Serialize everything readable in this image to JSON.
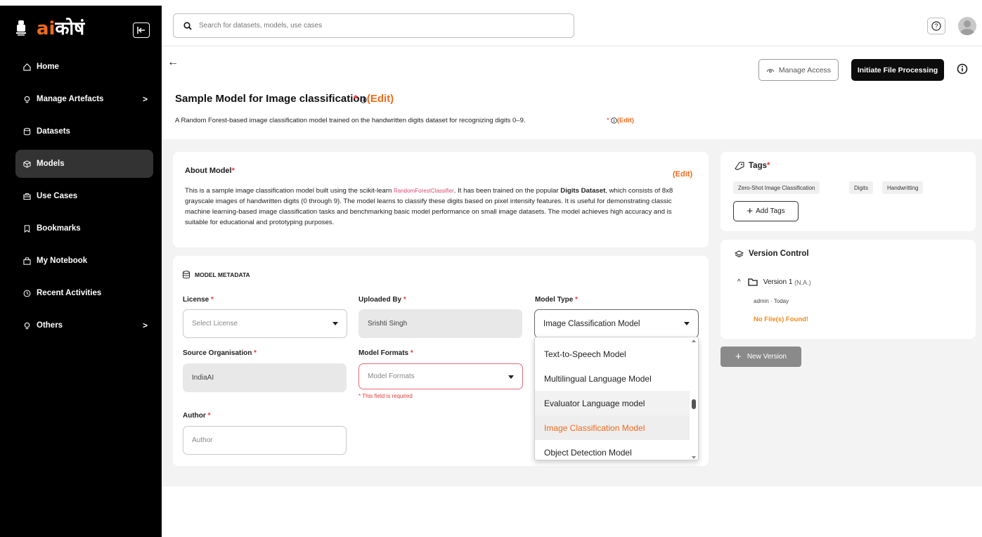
{
  "brand": {
    "prefix": "ai",
    "suffix": "कोषं"
  },
  "sidebar": {
    "items": [
      {
        "label": "Home",
        "icon": "home-icon"
      },
      {
        "label": "Manage Artefacts",
        "icon": "bulb-icon",
        "chevron": ">"
      },
      {
        "label": "Datasets",
        "icon": "database-icon"
      },
      {
        "label": "Models",
        "icon": "cube-icon",
        "active": true
      },
      {
        "label": "Use Cases",
        "icon": "briefcase-icon"
      },
      {
        "label": "Bookmarks",
        "icon": "bookmark-icon"
      },
      {
        "label": "My Notebook",
        "icon": "notebook-icon"
      },
      {
        "label": "Recent Activities",
        "icon": "clock-icon"
      },
      {
        "label": "Others",
        "icon": "bulb-icon",
        "chevron": ">"
      }
    ]
  },
  "search": {
    "placeholder": "Search for datasets, models, use cases"
  },
  "header": {
    "back": "←",
    "manage_access": "Manage Access",
    "initiate": "Initiate File Processing"
  },
  "page": {
    "title": "Sample Model for Image classification",
    "required_mark": "*",
    "edit": "(Edit)",
    "subtitle": "A Random Forest-based image classification model trained on the handwritten digits dataset for recognizing digits 0–9."
  },
  "about": {
    "title": "About Model",
    "required_mark": "*",
    "edit": "(Edit)",
    "text_1": "This is a sample image classification model built using the scikit-learn ",
    "code": "RandomForestClassifier",
    "text_2": ". It has been trained on the popular ",
    "bold_1": "Digits Dataset",
    "text_3": ", which consists of 8x8 grayscale images of handwritten digits (0 through 9). The model learns to classify these digits based on pixel intensity features. It is useful for demonstrating classic machine learning-based image classification tasks and benchmarking basic model performance on small image datasets. The model achieves high accuracy and is suitable for educational and prototyping purposes."
  },
  "metadata": {
    "heading": "MODEL METADATA",
    "license": {
      "label": "License",
      "required": "*",
      "placeholder": "Select License"
    },
    "uploaded_by": {
      "label": "Uploaded By",
      "required": "*",
      "value": "Srishti Singh"
    },
    "model_type": {
      "label": "Model Type",
      "required": "*",
      "value": "Image Classification Model"
    },
    "source_org": {
      "label": "Source Organisation",
      "required": "*",
      "value": "IndiaAI"
    },
    "model_formats": {
      "label": "Model Formats",
      "required": "*",
      "placeholder": "Model Formats",
      "error": "* This field is required"
    },
    "author": {
      "label": "Author",
      "required": "*",
      "placeholder": "Author"
    }
  },
  "model_type_options": [
    "Text-to-Speech Model",
    "Multilingual Language Model",
    "Evaluator Language model",
    "Image Classification Model",
    "Object Detection Model"
  ],
  "tags": {
    "title": "Tags",
    "required_mark": "*",
    "items": [
      "Zero-Shot Image Classification",
      "Digits",
      "Handwritting"
    ],
    "add": "Add Tags"
  },
  "version_control": {
    "title": "Version Control",
    "version": "Version 1",
    "version_note": "(N.A.)",
    "meta": "admin · Today",
    "empty": "No File(s) Found!",
    "new_version": "New Version"
  },
  "colors": {
    "accent": "#f06b1d",
    "sidebar_bg": "#000000",
    "error": "#e53935"
  }
}
